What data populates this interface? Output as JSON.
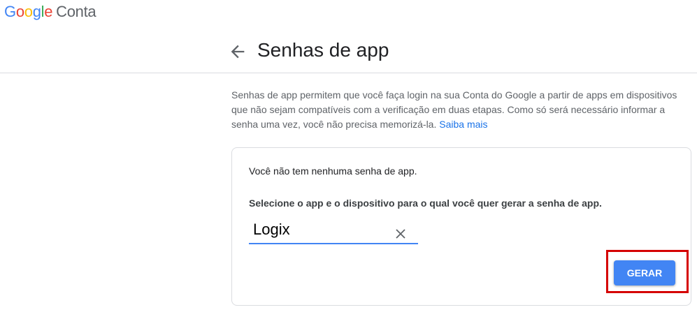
{
  "brand": {
    "logo_letters": [
      {
        "char": "G",
        "color": "#4285F4"
      },
      {
        "char": "o",
        "color": "#EA4335"
      },
      {
        "char": "o",
        "color": "#FBBC05"
      },
      {
        "char": "g",
        "color": "#4285F4"
      },
      {
        "char": "l",
        "color": "#34A853"
      },
      {
        "char": "e",
        "color": "#EA4335"
      }
    ],
    "product": "Conta"
  },
  "header": {
    "back_icon": "arrow-back-icon",
    "title": "Senhas de app"
  },
  "description": {
    "text": "Senhas de app permitem que você faça login na sua Conta do Google a partir de apps em dispositivos que não sejam compatíveis com a verificação em duas etapas. Como só será necessário informar a senha uma vez, você não precisa memorizá-la.",
    "link": "Saiba mais"
  },
  "card": {
    "empty_message": "Você não tem nenhuma senha de app.",
    "instruction": "Selecione o app e o dispositivo para o qual você quer gerar a senha de app.",
    "app_input_value": "Logix",
    "clear_icon": "close-icon",
    "generate_label": "GERAR"
  },
  "colors": {
    "accent": "#4285F4",
    "link": "#1a73e8",
    "highlight": "#d50000",
    "border": "#dadce0"
  }
}
